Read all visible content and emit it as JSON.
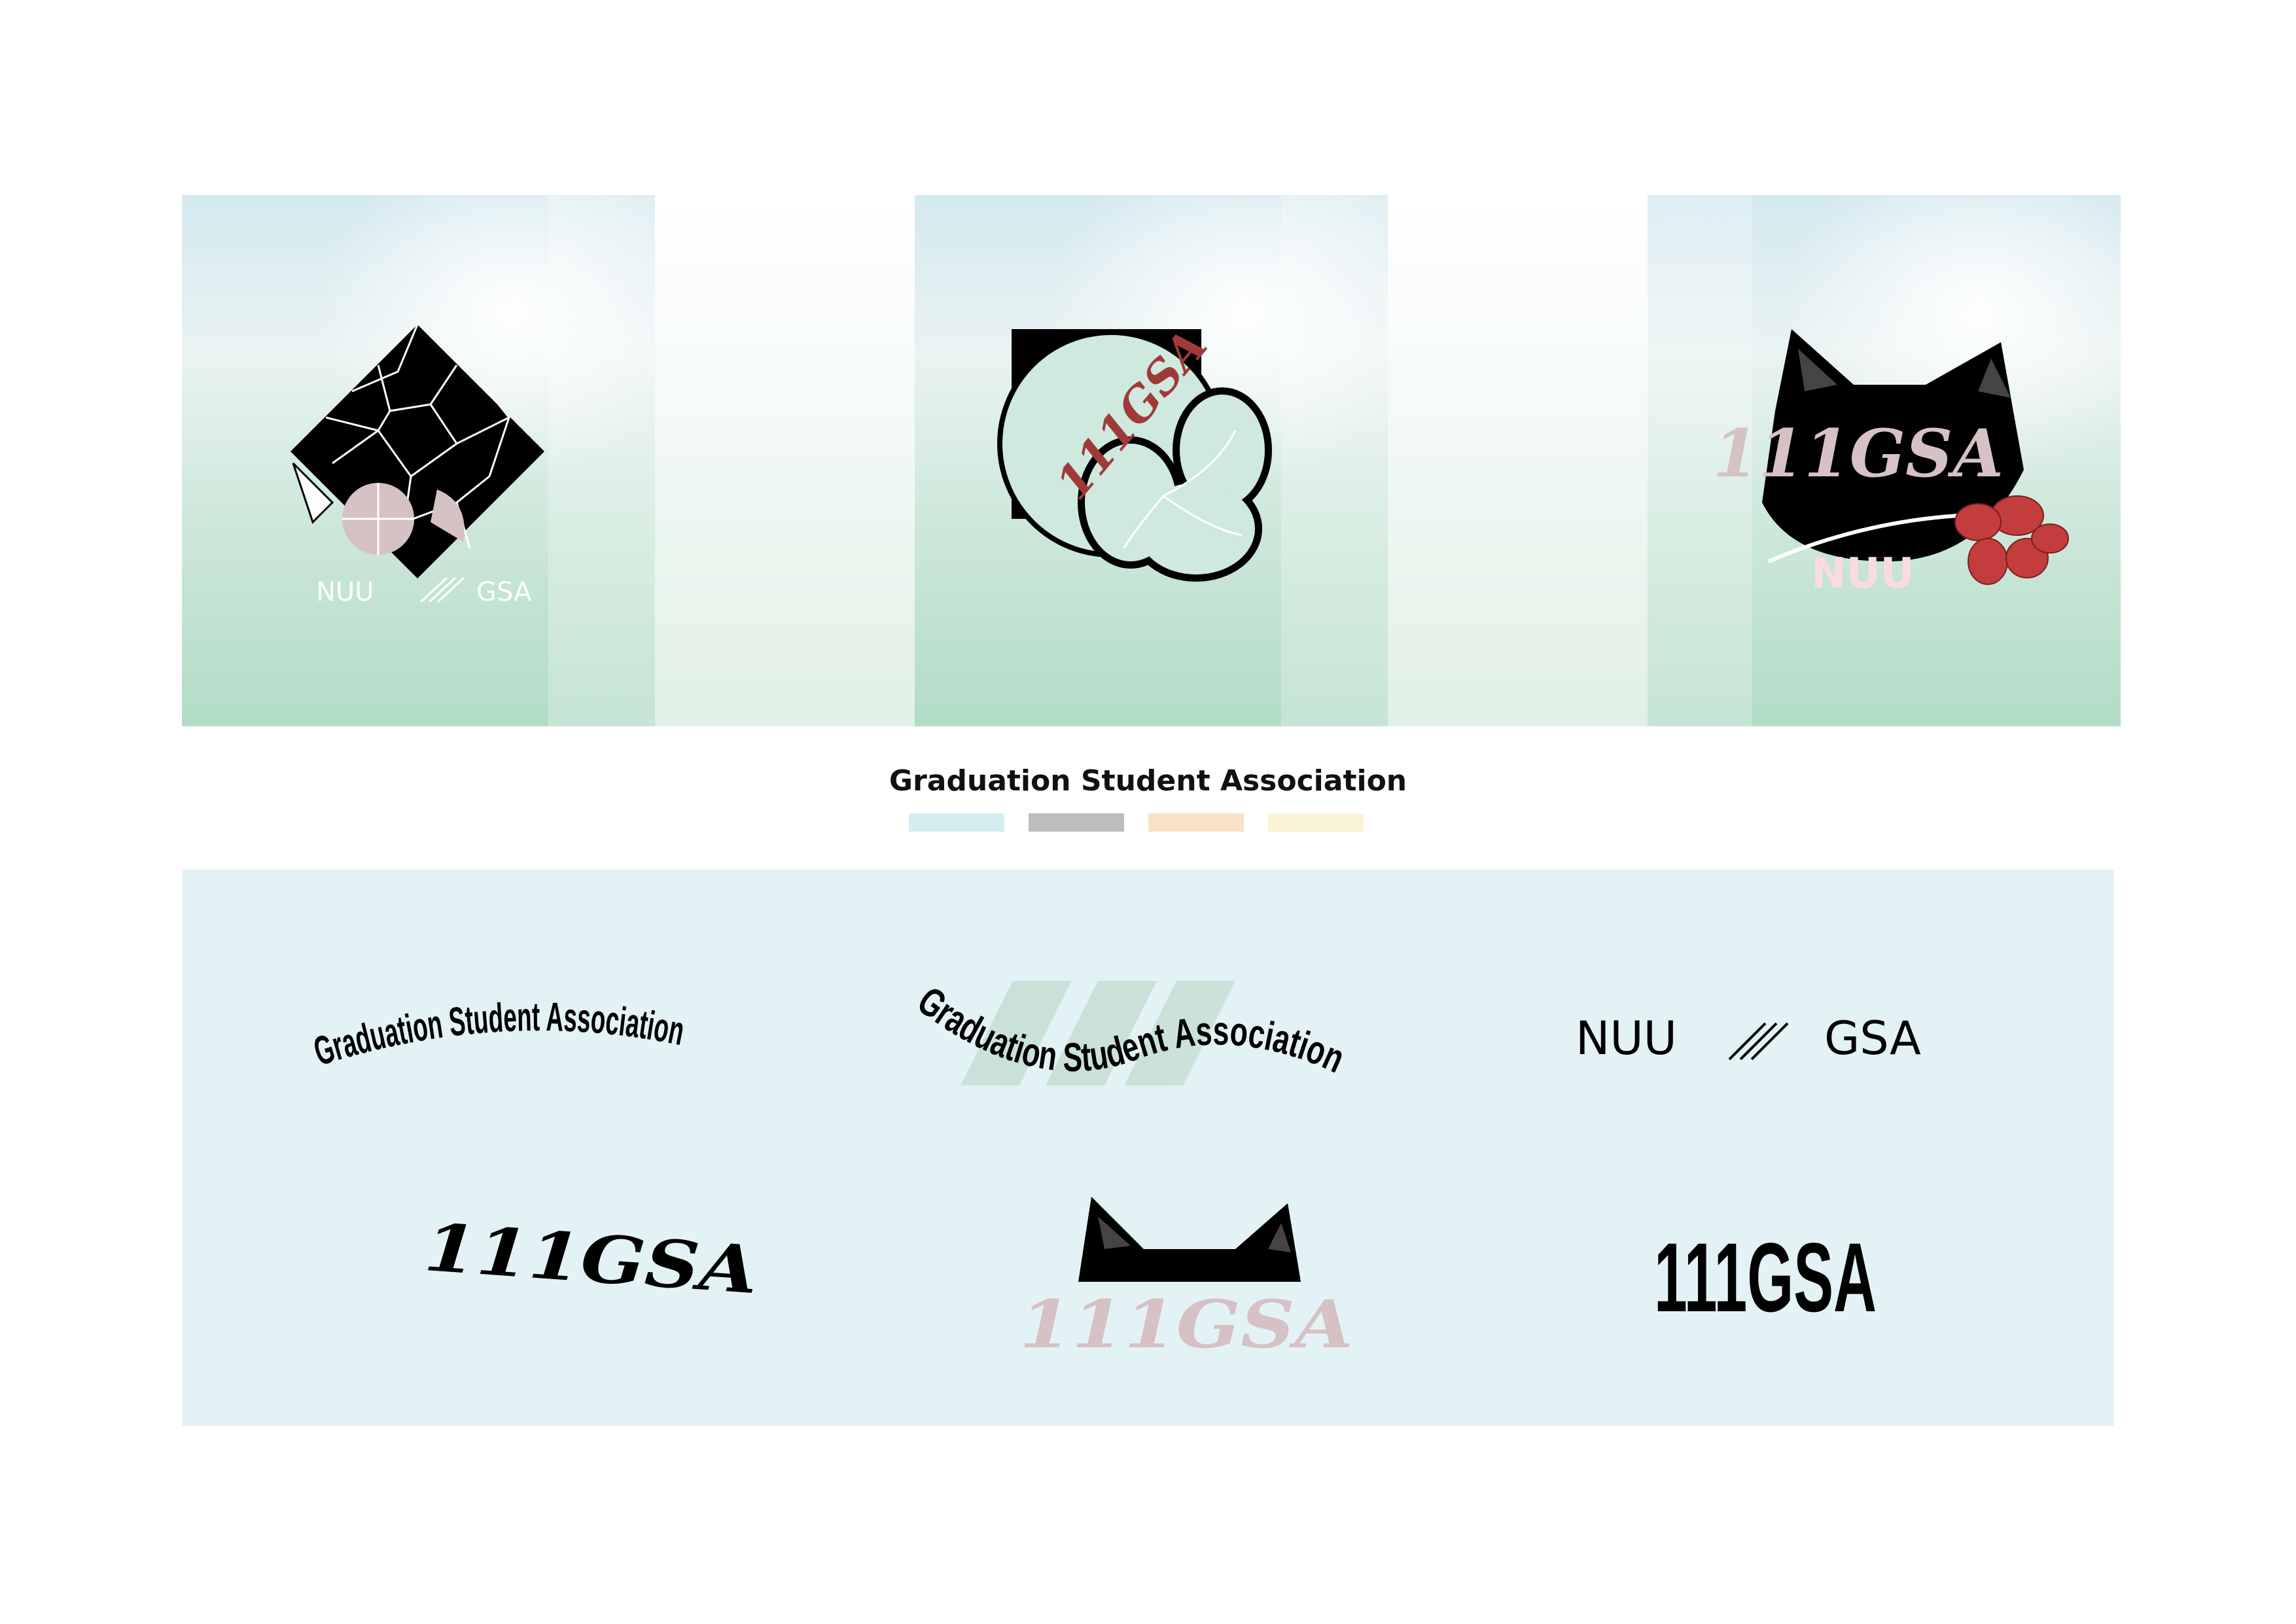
{
  "heading": "Graduation Student Association",
  "palette": [
    "#d3edf1",
    "#bdbdbd",
    "#f8e2c5",
    "#fbf3d6"
  ],
  "mockups": [
    {
      "name": "diamond-mosaic-mark",
      "wordmark": [
        "NUU",
        "GSA"
      ]
    },
    {
      "name": "flower-badge-mark",
      "wordmark": "111GSA"
    },
    {
      "name": "cat-head-mark",
      "wordmark": [
        "111GSA",
        "NUU"
      ]
    }
  ],
  "logo_variants": [
    {
      "name": "arched-wordmark",
      "text": "Graduation Student Association"
    },
    {
      "name": "wave-wordmark",
      "text": "Graduation Student Association"
    },
    {
      "name": "nuu-gsa-wordmark",
      "text": [
        "NUU",
        "GSA"
      ]
    },
    {
      "name": "italic-wordmark",
      "text": "111GSA"
    },
    {
      "name": "cat-ears-wordmark",
      "text": "111GSA"
    },
    {
      "name": "condensed-wordmark",
      "text": "111GSA"
    }
  ],
  "colors": {
    "ink": "#000000",
    "rose": "#d6c1c4",
    "red": "#c43d3d",
    "mint": "#cfe9de",
    "pale_blue": "#e3f2f5"
  }
}
